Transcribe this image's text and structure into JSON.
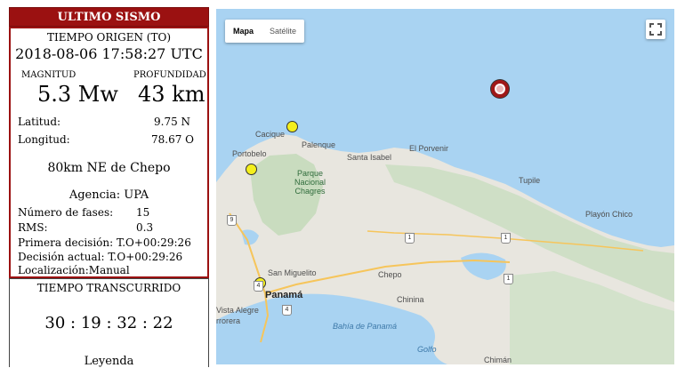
{
  "panel": {
    "header": "ULTIMO SISMO",
    "origin_label": "TIEMPO ORIGEN (TO)",
    "origin_time": "2018-08-06 17:58:27 UTC",
    "magnitude_label": "MAGNITUD",
    "magnitude": "5.3 Mw",
    "depth_label": "PROFUNDIDAD",
    "depth": "43 km",
    "lat_label": "Latitud:",
    "lat": "9.75 N",
    "lon_label": "Longitud:",
    "lon": "78.67 O",
    "location": "80km NE de Chepo",
    "agency": "Agencia: UPA",
    "phases_label": "Número de fases:",
    "phases": "15",
    "rms_label": "RMS:",
    "rms": "0.3",
    "first_decision": "Primera decisión: T.O+00:29:26",
    "current_decision": "Decisión actual: T.O+00:29:26",
    "localization": "Localización:Manual",
    "elapsed_label": "TIEMPO TRANSCURRIDO",
    "elapsed": "30 : 19 : 32 : 22",
    "legend": "Leyenda"
  },
  "map": {
    "type_map": "Mapa",
    "type_satellite": "Satélite",
    "labels": {
      "cacique": "Cacique",
      "palenque": "Palenque",
      "el_porvenir": "El Porvenir",
      "portobelo": "Portobelo",
      "santa_isabel": "Santa Isabel",
      "park": "Parque\nNacional\nChagres",
      "tupile": "Tupile",
      "playon_chico": "Playón Chico",
      "chepo": "Chepo",
      "san_miguelito": "San Miguelito",
      "panama": "Panamá",
      "vista_alegre": "Vista Alegre",
      "arraijan": "rrorera",
      "chinina": "Chinina",
      "bahia": "Bahía de Panamá",
      "golfo": "Golfo",
      "chiman": "Chimán"
    },
    "route_1a": "1",
    "route_1b": "1",
    "route_1c": "1",
    "route_9": "9",
    "route_4": "4",
    "route_4b": "4",
    "colors": {
      "water": "#a9d3f2",
      "land": "#e8e6df",
      "epicenter": "#a01818",
      "markers": "#f4ef1c"
    }
  }
}
